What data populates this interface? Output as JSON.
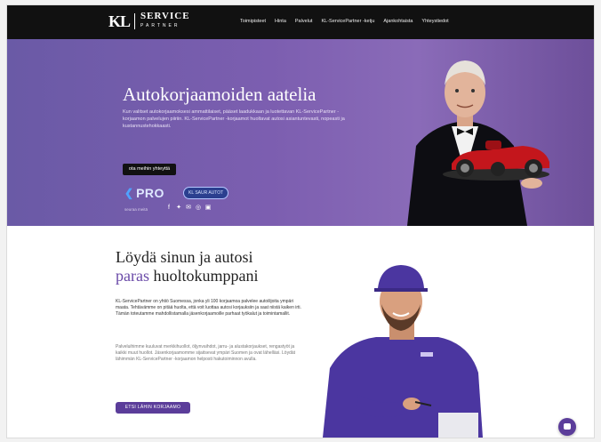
{
  "nav": {
    "logo_mark": "KL",
    "logo_line1": "SERVICE",
    "logo_line2": "PARTNER",
    "items": [
      "Toimipisteet",
      "Hinta",
      "Palvelut",
      "KL-ServicePartner -ketju",
      "Ajankohtaista",
      "Yhteystiedot"
    ]
  },
  "hero": {
    "title": "Autokorjaamoiden aatelia",
    "description": "Kun valitset autokorjaamoksesi ammattilaiset, pääset laadukkaan ja luotettavan KL-ServicePartner -korjaamon palvelujen piiriin. KL-ServicePartner -korjaamot huoltavat autosi asiantuntevasti, nopeasti ja kustannustehokkaasti.",
    "button_label": "ota meihin yhteyttä",
    "pro_label": "PRO",
    "badge_label": "KL SAUR AUTOT",
    "follow_label": "seuraa meitä"
  },
  "lower": {
    "title_line1": "Löydä sinun ja autosi",
    "title_accent": "paras",
    "title_rest": "huoltokumppani",
    "paragraph1": "KL-ServicePartner on yhtiö Suomessa, jonka yli 100 korjaamoa palvelee autoilijoita ympäri maata. Tehtävämme on pitää huolta, että voit luottaa autosi korjauksiin ja saat niistä kaiken irti. Tämän toteutamme mahdollistamalla jäsenkorjaamoille parhaat työkalut ja toimintamallit.",
    "paragraph2": "Palveluihimme kuuluvat merkkihuollot, öljynvaihdot, jarru- ja alustakorjaukset, rengastyöt ja kaikki muut huollot. Jäsenkorjaamomme sijaitsevat ympäri Suomen ja ovat lähelläsi. Löydät lähimmän KL-ServicePartner -korjaamon helposti hakutoiminnon avulla.",
    "button_label": "ETSI LÄHIN KORJAAMO"
  },
  "colors": {
    "nav_bg": "#111111",
    "hero_purple": "#7c5eb0",
    "accent": "#5b3d9a"
  }
}
